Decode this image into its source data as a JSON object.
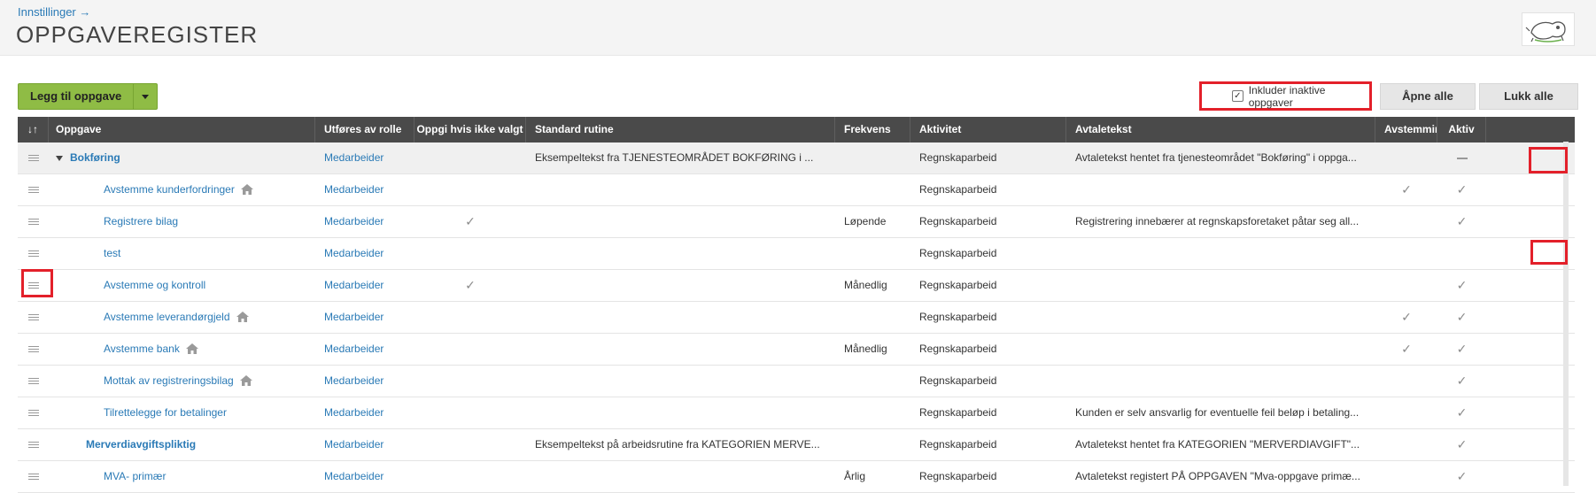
{
  "header": {
    "breadcrumb": "Innstillinger →",
    "title": "OPPGAVEREGISTER"
  },
  "toolbar": {
    "add_label": "Legg til oppgave",
    "include_inactive_label": "Inkluder inaktive oppgaver",
    "include_inactive_checked": true,
    "open_all": "Åpne alle",
    "close_all": "Lukk alle"
  },
  "table": {
    "columns": {
      "sort": "↓↑",
      "task": "Oppgave",
      "role": "Utføres av rolle",
      "report": "Oppgi hvis ikke valgt",
      "routine": "Standard rutine",
      "freq": "Frekvens",
      "activity": "Aktivitet",
      "agreement": "Avtaletekst",
      "reconcile": "Avstemming",
      "active": "Aktiv"
    },
    "rows": [
      {
        "task": "Bokføring",
        "role": "Medarbeider",
        "routine": "Eksempeltekst fra TJENESTEOMRÅDET BOKFØRING i ...",
        "freq": "",
        "activity": "Regnskaparbeid",
        "agreement": "Avtaletekst hentet fra tjenesteområdet \"Bokføring\" i oppga...",
        "reconcile": false,
        "active": "dash"
      },
      {
        "task": "Avstemme kunderfordringer",
        "role": "Medarbeider",
        "routine": "",
        "freq": "",
        "activity": "Regnskaparbeid",
        "agreement": "",
        "reconcile": true,
        "active": "check"
      },
      {
        "task": "Registrere bilag",
        "role": "Medarbeider",
        "routine": "",
        "freq": "Løpende",
        "activity": "Regnskaparbeid",
        "agreement": "Registrering innebærer at regnskapsforetaket påtar seg all...",
        "reconcile": false,
        "active": "check"
      },
      {
        "task": "test",
        "role": "Medarbeider",
        "routine": "",
        "freq": "",
        "activity": "Regnskaparbeid",
        "agreement": "",
        "reconcile": false,
        "active": "none"
      },
      {
        "task": "Avstemme og kontroll",
        "role": "Medarbeider",
        "routine": "",
        "freq": "Månedlig",
        "activity": "Regnskaparbeid",
        "agreement": "",
        "reconcile": false,
        "active": "check"
      },
      {
        "task": "Avstemme leverandørgjeld",
        "role": "Medarbeider",
        "routine": "",
        "freq": "",
        "activity": "Regnskaparbeid",
        "agreement": "",
        "reconcile": true,
        "active": "check"
      },
      {
        "task": "Avstemme bank",
        "role": "Medarbeider",
        "routine": "",
        "freq": "Månedlig",
        "activity": "Regnskaparbeid",
        "agreement": "",
        "reconcile": true,
        "active": "check"
      },
      {
        "task": "Mottak av registreringsbilag",
        "role": "Medarbeider",
        "routine": "",
        "freq": "",
        "activity": "Regnskaparbeid",
        "agreement": "",
        "reconcile": false,
        "active": "check"
      },
      {
        "task": "Tilrettelegge for betalinger",
        "role": "Medarbeider",
        "routine": "",
        "freq": "",
        "activity": "Regnskaparbeid",
        "agreement": "Kunden er selv ansvarlig for eventuelle feil beløp i betaling...",
        "reconcile": false,
        "active": "check"
      },
      {
        "task": "Merverdiavgiftspliktig",
        "role": "Medarbeider",
        "routine": "Eksempeltekst på arbeidsrutine fra KATEGORIEN MERVE...",
        "freq": "",
        "activity": "Regnskaparbeid",
        "agreement": "Avtaletekst hentet fra KATEGORIEN \"MERVERDIAVGIFT\"...",
        "reconcile": false,
        "active": "check"
      },
      {
        "task": "MVA- primær",
        "role": "Medarbeider",
        "routine": "",
        "freq": "Årlig",
        "activity": "Regnskaparbeid",
        "agreement": "Avtaletekst registert PÅ OPPGAVEN \"Mva-oppgave primæ...",
        "reconcile": false,
        "active": "check"
      }
    ]
  },
  "icons": {
    "checkbox": "check-icon",
    "check_glyph": "✓",
    "home": "home-icon",
    "drag": "drag-handle-icon",
    "expand": "chevron-down-icon"
  },
  "colors": {
    "link": "#2a7ab6",
    "header_bg": "#4a4a4a",
    "add_button": "#8fbc45",
    "highlight": "#e3202a"
  }
}
